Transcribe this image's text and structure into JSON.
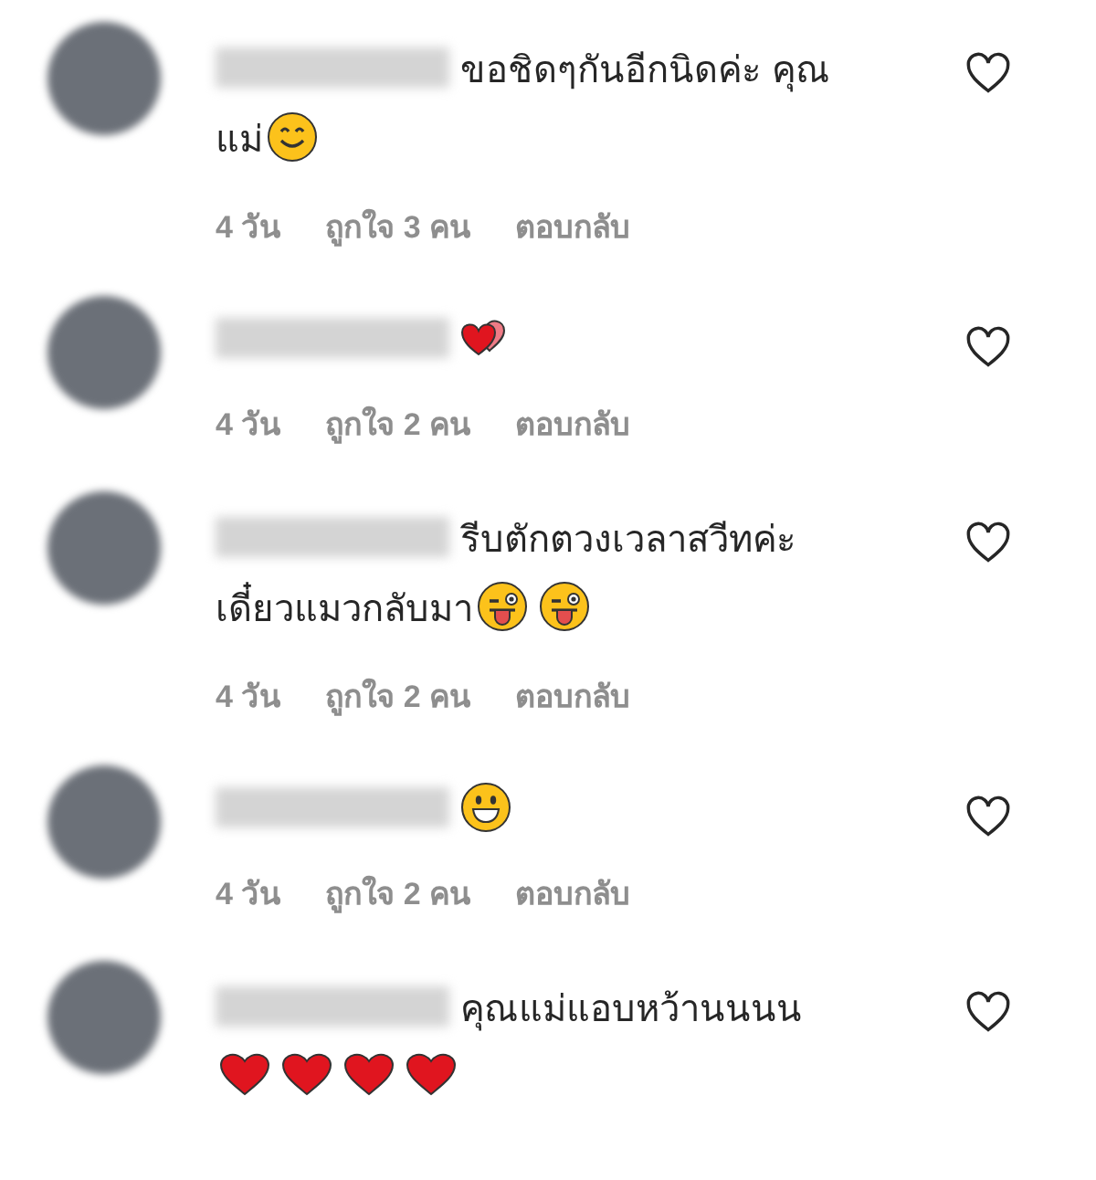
{
  "comments": [
    {
      "text_lines": [
        "ขอชิดๆกันอีกนิดค่ะ คุณ",
        "แม่"
      ],
      "emojis": [
        {
          "kind": "smile"
        }
      ],
      "meta": [
        "4 วัน",
        "ถูกใจ 3 คน",
        "ตอบกลับ"
      ],
      "liked": false
    },
    {
      "emojis": [
        {
          "kind": "two-hearts"
        }
      ],
      "meta": [
        "4 วัน",
        "ถูกใจ 2 คน",
        "ตอบกลับ"
      ],
      "liked": false
    },
    {
      "text_lines": [
        "รีบตักตวงเวลาสวีทค่ะ",
        "เดี๋ยวแมวกลับมา"
      ],
      "emojis": [
        {
          "kind": "tongue-wink"
        },
        {
          "kind": "tongue-wink"
        }
      ],
      "meta": [
        "4 วัน",
        "ถูกใจ 2 คน",
        "ตอบกลับ"
      ],
      "liked": false
    },
    {
      "emojis": [
        {
          "kind": "grin"
        }
      ],
      "meta": [
        "4 วัน",
        "ถูกใจ 2 คน",
        "ตอบกลับ"
      ],
      "liked": false
    },
    {
      "text_lines": [
        "คุณแม่แอบหว้านนนน"
      ],
      "emojis": [
        {
          "kind": "heart"
        },
        {
          "kind": "heart"
        },
        {
          "kind": "heart"
        },
        {
          "kind": "heart"
        }
      ],
      "liked": false
    }
  ]
}
